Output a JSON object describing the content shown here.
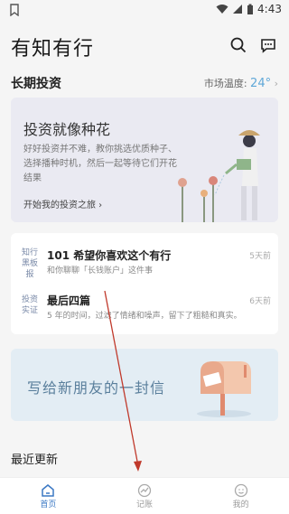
{
  "status_bar": {
    "time": "4:43"
  },
  "app": {
    "title": "有知有行"
  },
  "section": {
    "title": "长期投资",
    "temp_label": "市场温度:",
    "temp_value": "24°"
  },
  "banner": {
    "heading": "投资就像种花",
    "body": "好好投资并不难，教你挑选优质种子、选择播种时机，然后一起等待它们开花结果",
    "link": "开始我的投资之旅 ›"
  },
  "articles": [
    {
      "tag": "知行黑板报",
      "title": "101 希望你喜欢这个有行",
      "subtitle": "和你聊聊「长钱账户」这件事",
      "date": "5天前"
    },
    {
      "tag": "投资实证",
      "title": "最后四篇",
      "subtitle": "5 年的时间，过滤了情绪和噪声，留下了粗糙和真实。",
      "date": "6天前"
    }
  ],
  "letter_banner": {
    "heading": "写给新朋友的一封信"
  },
  "recent": {
    "title": "最近更新"
  },
  "tabs": [
    {
      "label": "首页",
      "icon": "home-icon",
      "active": true
    },
    {
      "label": "记账",
      "icon": "chart-icon",
      "active": false
    },
    {
      "label": "我的",
      "icon": "profile-icon",
      "active": false
    }
  ],
  "colors": {
    "accent": "#3b78c4",
    "temp": "#5fa8d8",
    "annotation": "#c0392b"
  }
}
